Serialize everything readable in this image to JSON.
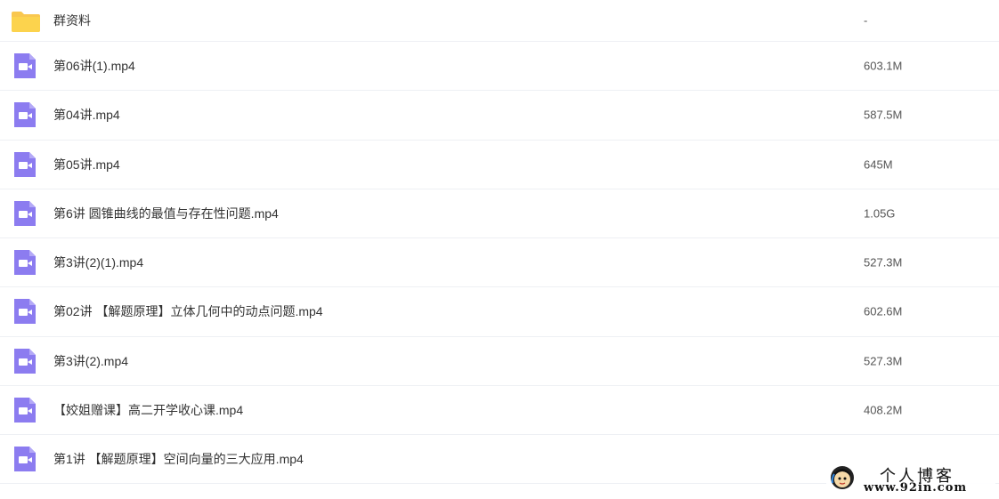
{
  "files": [
    {
      "name": "群资料",
      "size": "-",
      "type": "folder",
      "icon": "folder-icon"
    },
    {
      "name": "第06讲(1).mp4",
      "size": "603.1M",
      "type": "video",
      "icon": "video-file-icon"
    },
    {
      "name": "第04讲.mp4",
      "size": "587.5M",
      "type": "video",
      "icon": "video-file-icon"
    },
    {
      "name": "第05讲.mp4",
      "size": "645M",
      "type": "video",
      "icon": "video-file-icon"
    },
    {
      "name": "第6讲 圆锥曲线的最值与存在性问题.mp4",
      "size": "1.05G",
      "type": "video",
      "icon": "video-file-icon"
    },
    {
      "name": "第3讲(2)(1).mp4",
      "size": "527.3M",
      "type": "video",
      "icon": "video-file-icon"
    },
    {
      "name": "第02讲 【解题原理】立体几何中的动点问题.mp4",
      "size": "602.6M",
      "type": "video",
      "icon": "video-file-icon"
    },
    {
      "name": "第3讲(2).mp4",
      "size": "527.3M",
      "type": "video",
      "icon": "video-file-icon"
    },
    {
      "name": "【姣姐赠课】高二开学收心课.mp4",
      "size": "408.2M",
      "type": "video",
      "icon": "video-file-icon"
    },
    {
      "name": "第1讲 【解题原理】空间向量的三大应用.mp4",
      "size": "",
      "type": "video",
      "icon": "video-file-icon"
    }
  ],
  "watermark": {
    "title": "个人博客",
    "url": "www.92in.com"
  },
  "colors": {
    "folder": "#fcd34d",
    "video": "#8c7cf0",
    "divider": "#eef0f4"
  }
}
